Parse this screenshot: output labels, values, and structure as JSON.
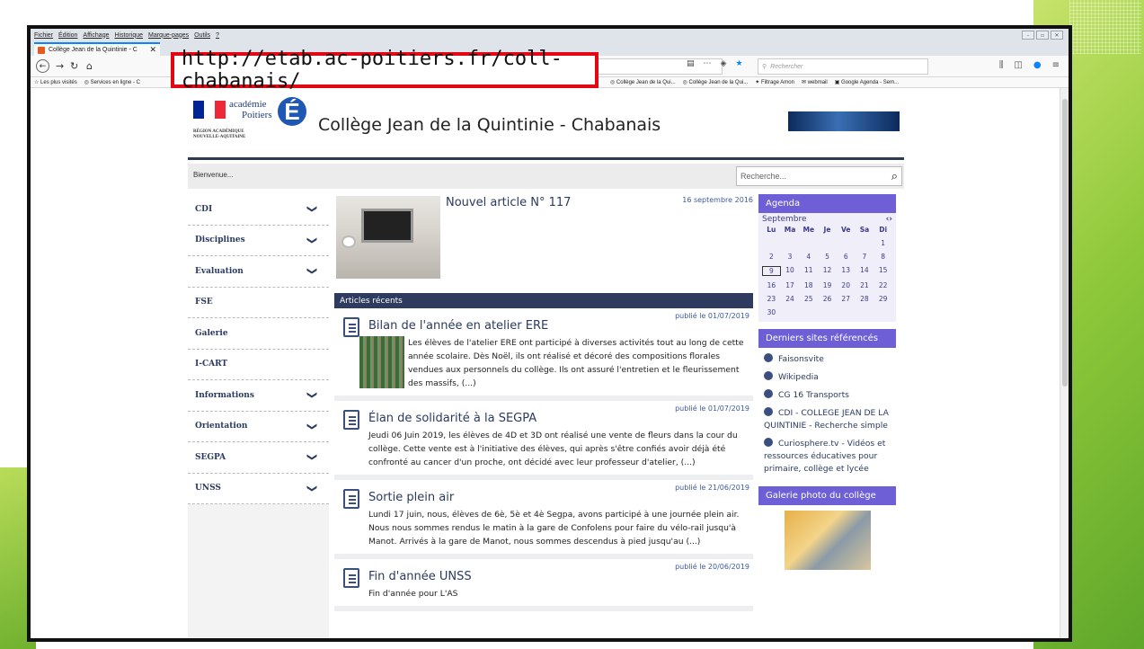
{
  "browser": {
    "menu": [
      "Fichier",
      "Édition",
      "Affichage",
      "Historique",
      "Marque-pages",
      "Outils",
      "?"
    ],
    "tab_title": "Collège Jean de la Quintinie - C",
    "tab_close": "✕",
    "url": "http://etab.ac-poitiers.fr/coll-chabanais/",
    "search_placeholder": "Rechercher",
    "bookmarks_left": [
      "Les plus visités",
      "Services en ligne - C"
    ],
    "bookmarks_right": [
      "Collège Jean de la Qui...",
      "Collège Jean de la Qui...",
      "Filtrage Amon",
      "webmail",
      "Google Agenda - Sem..."
    ]
  },
  "site": {
    "academie_line1": "académie",
    "academie_line2": "Poitiers",
    "academie_letter": "É",
    "region": "RÉGION ACADÉMIQUE\nNOUVELLE-AQUITAINE",
    "title": "Collège Jean de la Quintinie - Chabanais",
    "welcome": "Bienvenue...",
    "search_placeholder": "Recherche...",
    "nav": [
      {
        "label": "CDI",
        "chevron": "❯"
      },
      {
        "label": "Disciplines",
        "chevron": "❯"
      },
      {
        "label": "Evaluation",
        "chevron": "❯"
      },
      {
        "label": "FSE",
        "chevron": ""
      },
      {
        "label": "Galerie",
        "chevron": ""
      },
      {
        "label": "I-CART",
        "chevron": ""
      },
      {
        "label": "Informations",
        "chevron": "❯"
      },
      {
        "label": "Orientation",
        "chevron": "❯"
      },
      {
        "label": "SEGPA",
        "chevron": "❯"
      },
      {
        "label": "UNSS",
        "chevron": "❯"
      }
    ],
    "feature": {
      "title": "Nouvel article N° 117",
      "date": "16 septembre 2016"
    },
    "recent_heading": "Articles récents",
    "articles": [
      {
        "date": "publié le 01/07/2019",
        "title": "Bilan de l'année en atelier ERE",
        "body": "Les élèves de l'atelier ERE ont participé à diverses activités tout au long de cette année scolaire. Dès Noël, ils ont réalisé et décoré des compositions florales vendues aux personnels du collège. Ils ont assuré l'entretien et le fleurissement des massifs, (...)"
      },
      {
        "date": "publié le 01/07/2019",
        "title": "Élan de solidarité à la SEGPA",
        "body": "Jeudi 06 Juin 2019, les élèves de 4D et 3D ont réalisé une vente de fleurs dans la cour du collège. Cette vente est à l'initiative des élèves, qui après s'être confiés avoir déjà été confronté au cancer d'un proche, ont décidé avec leur professeur d'atelier, (...)"
      },
      {
        "date": "publié le 21/06/2019",
        "title": "Sortie plein air",
        "body": "Lundi 17 juin, nous, élèves de 6è, 5è et 4è Segpa, avons participé à une journée plein air. Nous nous sommes rendus le matin à la gare de Confolens pour faire du vélo-rail jusqu'à Manot. Arrivés à la gare de Manot, nous sommes descendus à pied jusqu'au (...)"
      },
      {
        "date": "publié le 20/06/2019",
        "title": "Fin d'année UNSS",
        "body": "Fin d'année pour L'AS"
      }
    ],
    "agenda": {
      "heading": "Agenda",
      "month": "Septembre",
      "arrows": "‹›",
      "days": [
        "Lu",
        "Ma",
        "Me",
        "Je",
        "Ve",
        "Sa",
        "Di"
      ],
      "weeks": [
        [
          "",
          "",
          "",
          "",
          "",
          "",
          "1"
        ],
        [
          "2",
          "3",
          "4",
          "5",
          "6",
          "7",
          "8"
        ],
        [
          "9",
          "10",
          "11",
          "12",
          "13",
          "14",
          "15"
        ],
        [
          "16",
          "17",
          "18",
          "19",
          "20",
          "21",
          "22"
        ],
        [
          "23",
          "24",
          "25",
          "26",
          "27",
          "28",
          "29"
        ],
        [
          "30",
          "",
          "",
          "",
          "",
          "",
          ""
        ]
      ],
      "today": "9"
    },
    "sites_heading": "Derniers sites référencés",
    "sites": [
      "Faisonsvite",
      "Wikipedia",
      "CG 16 Transports",
      "CDI - COLLEGE JEAN DE LA QUINTINIE - Recherche simple",
      "Curiosphere.tv - Vidéos et ressources éducatives pour primaire, collège et lycée"
    ],
    "gallery_heading": "Galerie photo du collège"
  }
}
